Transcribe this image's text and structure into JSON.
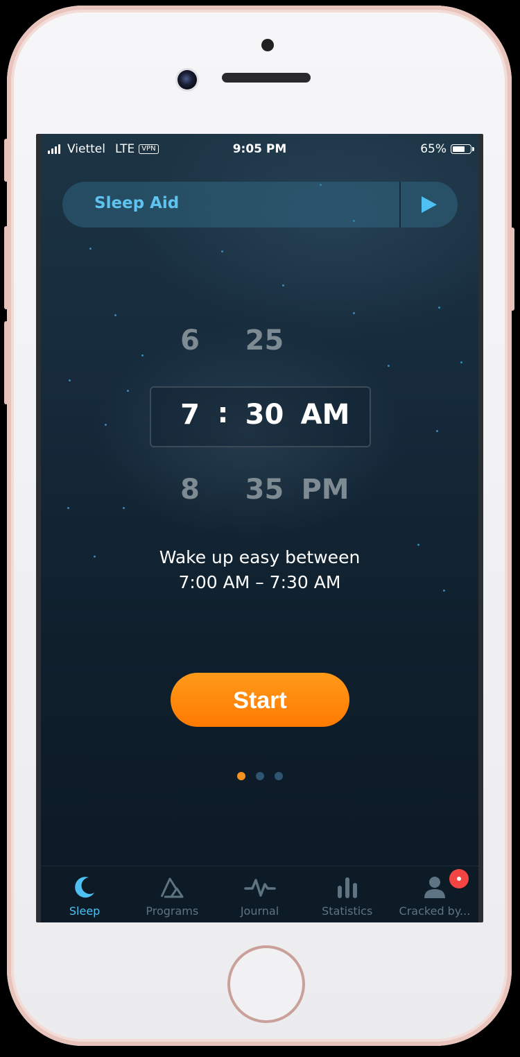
{
  "status_bar": {
    "carrier": "Viettel",
    "network": "LTE",
    "vpn": "VPN",
    "time": "9:05 PM",
    "battery": "65%"
  },
  "sleep_aid": {
    "label": "Sleep Aid",
    "play_icon": "play-icon"
  },
  "picker": {
    "above": {
      "hour": "6",
      "minute": "25"
    },
    "selected": {
      "hour": "7",
      "separator": ":",
      "minute": "30",
      "period": "AM"
    },
    "below": {
      "hour": "8",
      "minute": "35",
      "period": "PM"
    }
  },
  "wake_text": {
    "line1": "Wake up easy between",
    "line2": "7:00 AM – 7:30 AM"
  },
  "start_button": {
    "label": "Start"
  },
  "page_indicator": {
    "count": 3,
    "active": 0
  },
  "tabbar": {
    "tabs": [
      {
        "label": "Sleep",
        "icon": "moon-icon",
        "active": true
      },
      {
        "label": "Programs",
        "icon": "programs-icon",
        "active": false
      },
      {
        "label": "Journal",
        "icon": "pulse-icon",
        "active": false
      },
      {
        "label": "Statistics",
        "icon": "bar-chart-icon",
        "active": false
      },
      {
        "label": "Cracked by...",
        "icon": "profile-icon",
        "active": false
      }
    ]
  },
  "colors": {
    "accent_blue": "#4ec1f2",
    "accent_orange": "#ff8a0a",
    "badge_red": "#f24443"
  }
}
